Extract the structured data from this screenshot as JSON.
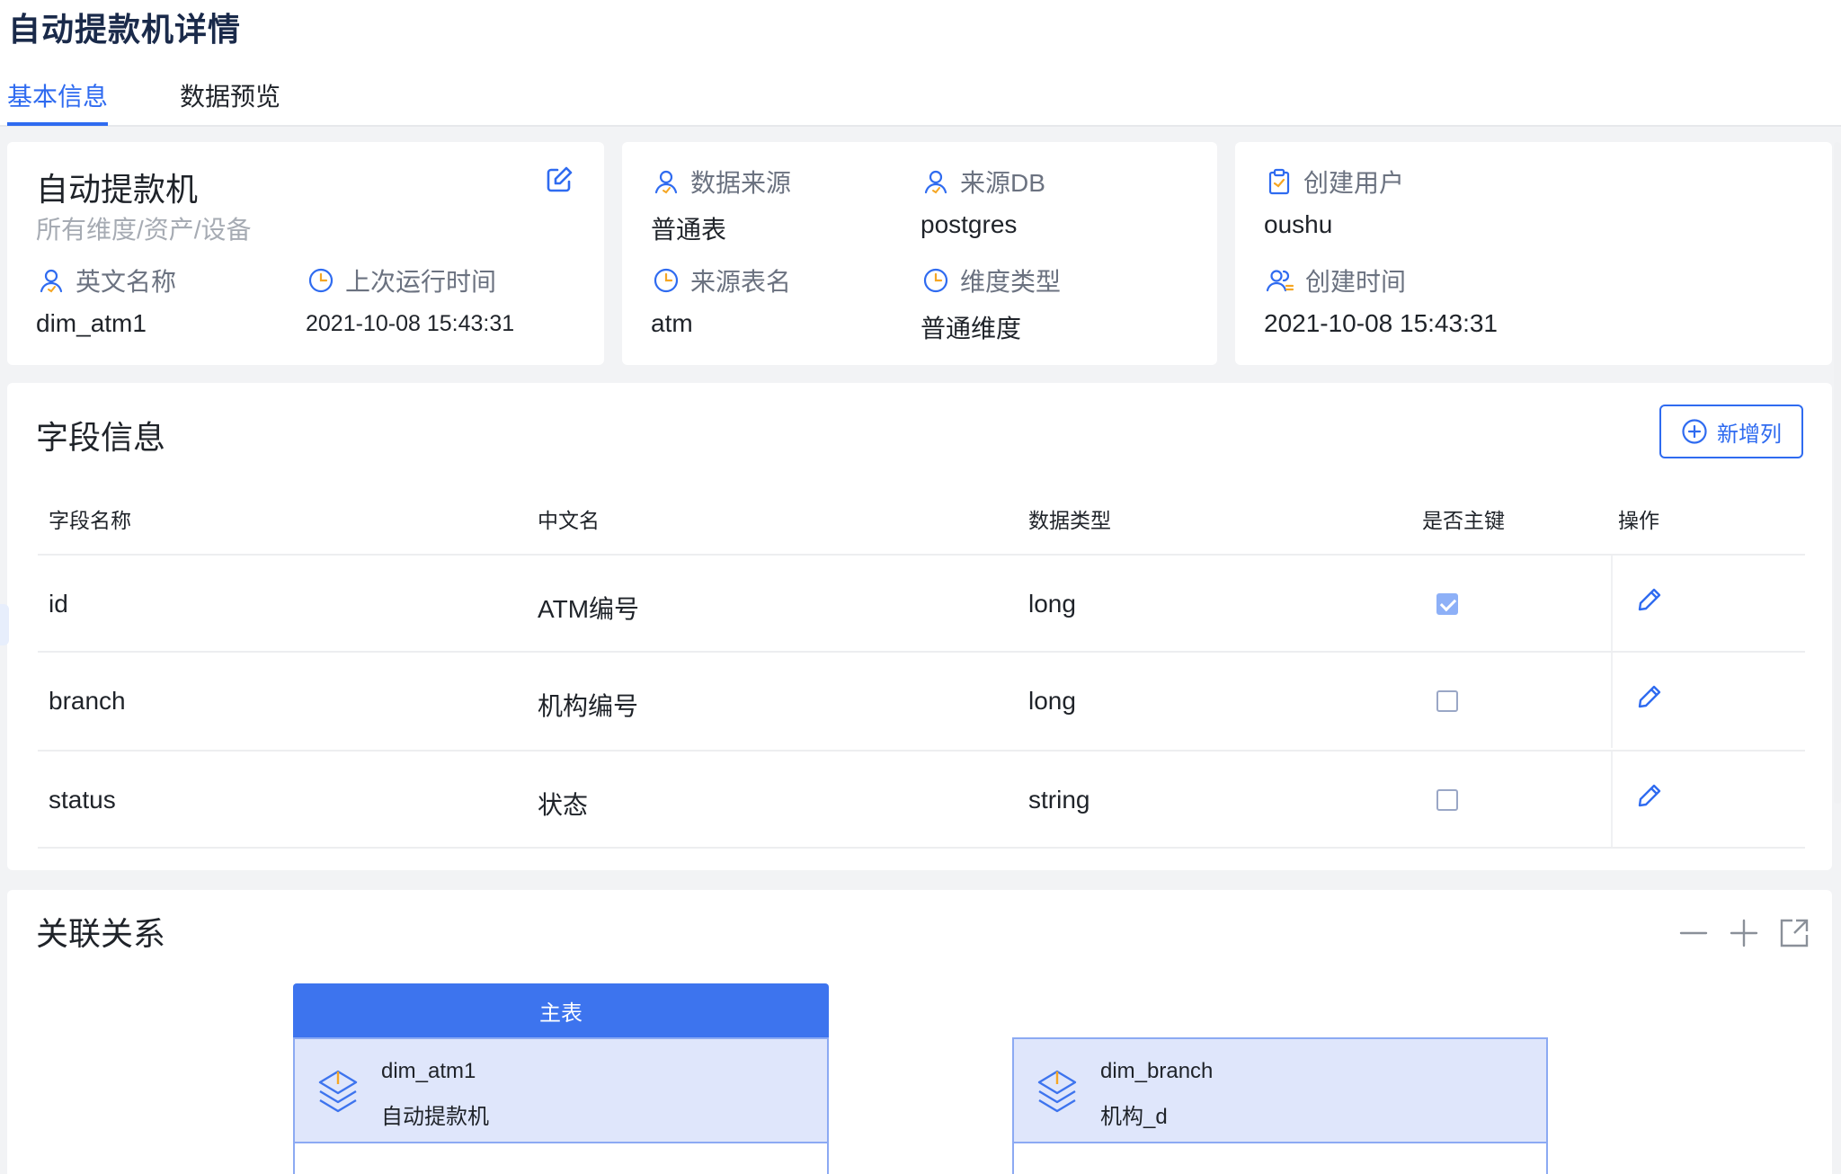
{
  "header": {
    "title": "自动提款机详情",
    "tabs": [
      {
        "label": "基本信息",
        "active": true
      },
      {
        "label": "数据预览",
        "active": false
      }
    ]
  },
  "summary": {
    "name": "自动提款机",
    "path": "所有维度/资产/设备",
    "english_name_label": "英文名称",
    "english_name": "dim_atm1",
    "last_run_label": "上次运行时间",
    "last_run": "2021-10-08 15:43:31"
  },
  "source": {
    "data_source_label": "数据来源",
    "data_source": "普通表",
    "source_db_label": "来源DB",
    "source_db": "postgres",
    "source_table_label": "来源表名",
    "source_table": "atm",
    "dim_type_label": "维度类型",
    "dim_type": "普通维度"
  },
  "creator": {
    "user_label": "创建用户",
    "user": "oushu",
    "created_label": "创建时间",
    "created": "2021-10-08 15:43:31"
  },
  "fields": {
    "title": "字段信息",
    "add_label": "新增列",
    "columns": [
      "字段名称",
      "中文名",
      "数据类型",
      "是否主键",
      "操作"
    ],
    "rows": [
      {
        "name": "id",
        "cn": "ATM编号",
        "type": "long",
        "pk": true
      },
      {
        "name": "branch",
        "cn": "机构编号",
        "type": "long",
        "pk": false
      },
      {
        "name": "status",
        "cn": "状态",
        "type": "string",
        "pk": false
      }
    ]
  },
  "relations": {
    "title": "关联关系",
    "main_label": "主表",
    "nodes": [
      {
        "name": "dim_atm1",
        "cn": "自动提款机"
      },
      {
        "name": "dim_branch",
        "cn": "机构_d"
      }
    ]
  },
  "colors": {
    "accent": "#2f6bf0",
    "node_header": "#3d74ee",
    "node_body": "#dfe6fb"
  },
  "icons": [
    "edit-icon",
    "user-icon",
    "clock-icon",
    "clipboard-icon",
    "users-icon",
    "plus-circle-icon",
    "pencil-icon",
    "minus-icon",
    "plus-icon",
    "fullscreen-icon",
    "cube-icon"
  ]
}
